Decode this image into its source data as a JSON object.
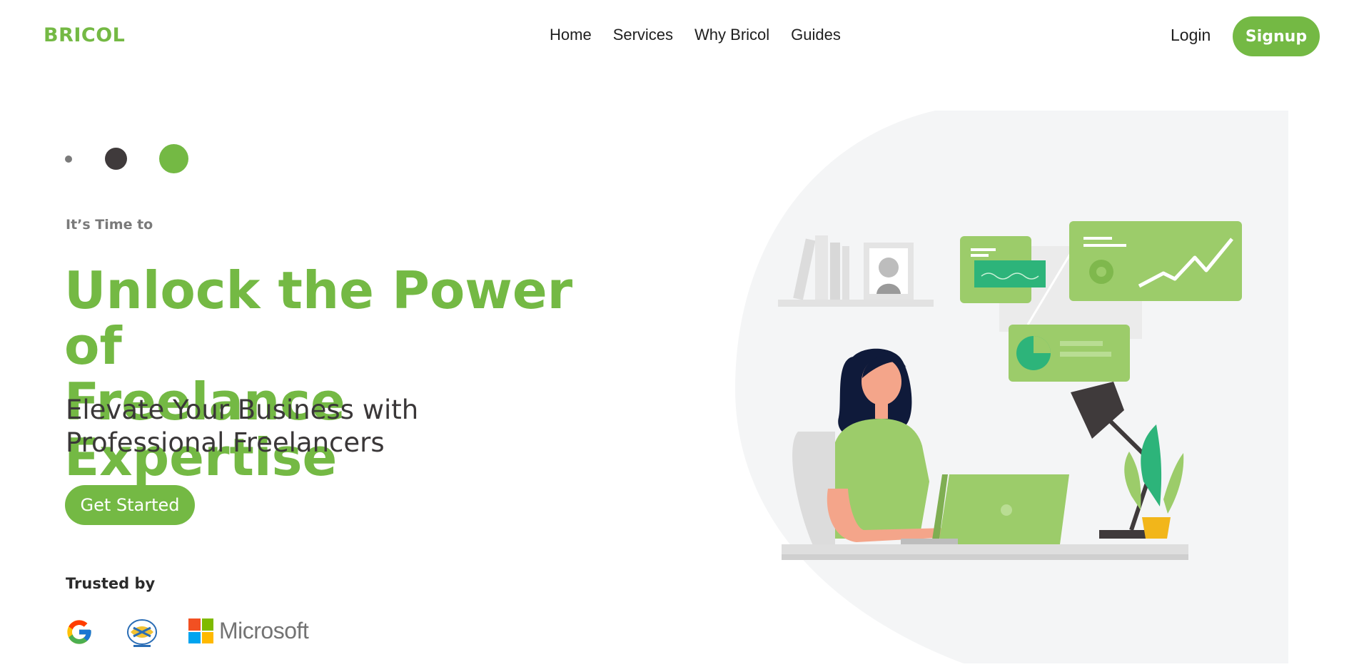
{
  "header": {
    "brand": "BRICOL",
    "nav": [
      "Home",
      "Services",
      "Why Bricol",
      "Guides"
    ],
    "login": "Login",
    "signup": "Signup"
  },
  "hero": {
    "kicker": "It’s Time to",
    "headline_line1": "Unlock the Power of",
    "headline_line2": "Freelance Expertise",
    "subhead": "Elevate Your Business with Professional Freelancers",
    "cta": "Get Started"
  },
  "trusted": {
    "label": "Trusted by",
    "logos": [
      "google-logo",
      "emblem-logo",
      "microsoft-logo"
    ],
    "microsoft_text": "Microsoft"
  },
  "colors": {
    "accent": "#74b944",
    "dark_dot": "#3f3a3b",
    "grey_dot": "#7a7a7a",
    "panel_bg": "#f4f5f6"
  },
  "icons": {
    "google": "google-icon",
    "emblem": "emblem-icon",
    "microsoft": "microsoft-icon"
  }
}
